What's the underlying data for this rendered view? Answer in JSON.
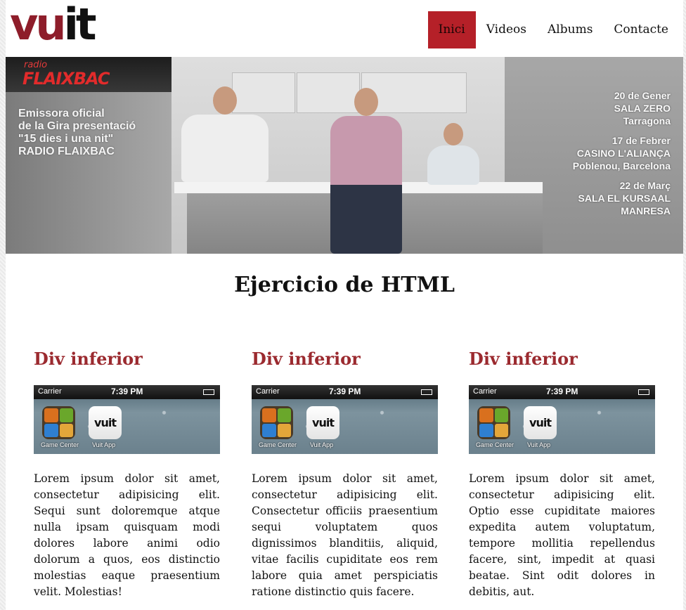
{
  "header": {
    "logo_part1": "vu",
    "logo_part2": "it",
    "nav": [
      {
        "label": "Inici",
        "active": true
      },
      {
        "label": "Videos",
        "active": false
      },
      {
        "label": "Albums",
        "active": false
      },
      {
        "label": "Contacte",
        "active": false
      }
    ]
  },
  "hero": {
    "radio_small": "radio",
    "radio_big": "FLAIXBAC",
    "left_lines": [
      "Emissora oficial",
      "de la Gira presentació",
      "\"15 dies i una nit\"",
      "RADIO  FLAIXBAC"
    ],
    "events": [
      {
        "date": "20 de Gener",
        "venue": "SALA ZERO",
        "city": "Tarragona"
      },
      {
        "date": "17 de Febrer",
        "venue": "CASINO L'ALIANÇA",
        "city": "Poblenou, Barcelona"
      },
      {
        "date": "22 de Març",
        "venue": "SALA EL KURSAAL",
        "city": "MANRESA"
      }
    ]
  },
  "main": {
    "title": "Ejercicio de HTML",
    "columns": [
      {
        "heading": "Div inferior",
        "text": "Lorem ipsum dolor sit amet, consectetur adipisicing elit. Sequi sunt doloremque atque nulla ipsam quisquam modi dolores labore animi odio dolorum a quos, eos distinctio molestias eaque praesentium velit. Molestias!"
      },
      {
        "heading": "Div inferior",
        "text": "Lorem ipsum dolor sit amet, consectetur adipisicing elit. Consectetur officiis praesentium sequi voluptatem quos dignissimos blanditiis, aliquid, vitae facilis cupiditate eos rem labore quia amet perspiciatis ratione distinctio quis facere."
      },
      {
        "heading": "Div inferior",
        "text": "Lorem ipsum dolor sit amet, consectetur adipisicing elit. Optio esse cupiditate maiores expedita autem voluptatum, tempore mollitia repellendus facere, sint, impedit at quasi beatae. Sint odit dolores in debitis, aut."
      }
    ]
  },
  "phone": {
    "carrier": "Carrier",
    "time": "7:39 PM",
    "app1": "Game Center",
    "app2": "Vuit App",
    "app2_icon_text": "vuit"
  },
  "colors": {
    "accent": "#b52028",
    "heading": "#9b2a2f",
    "logo": "#8e1d2a"
  }
}
